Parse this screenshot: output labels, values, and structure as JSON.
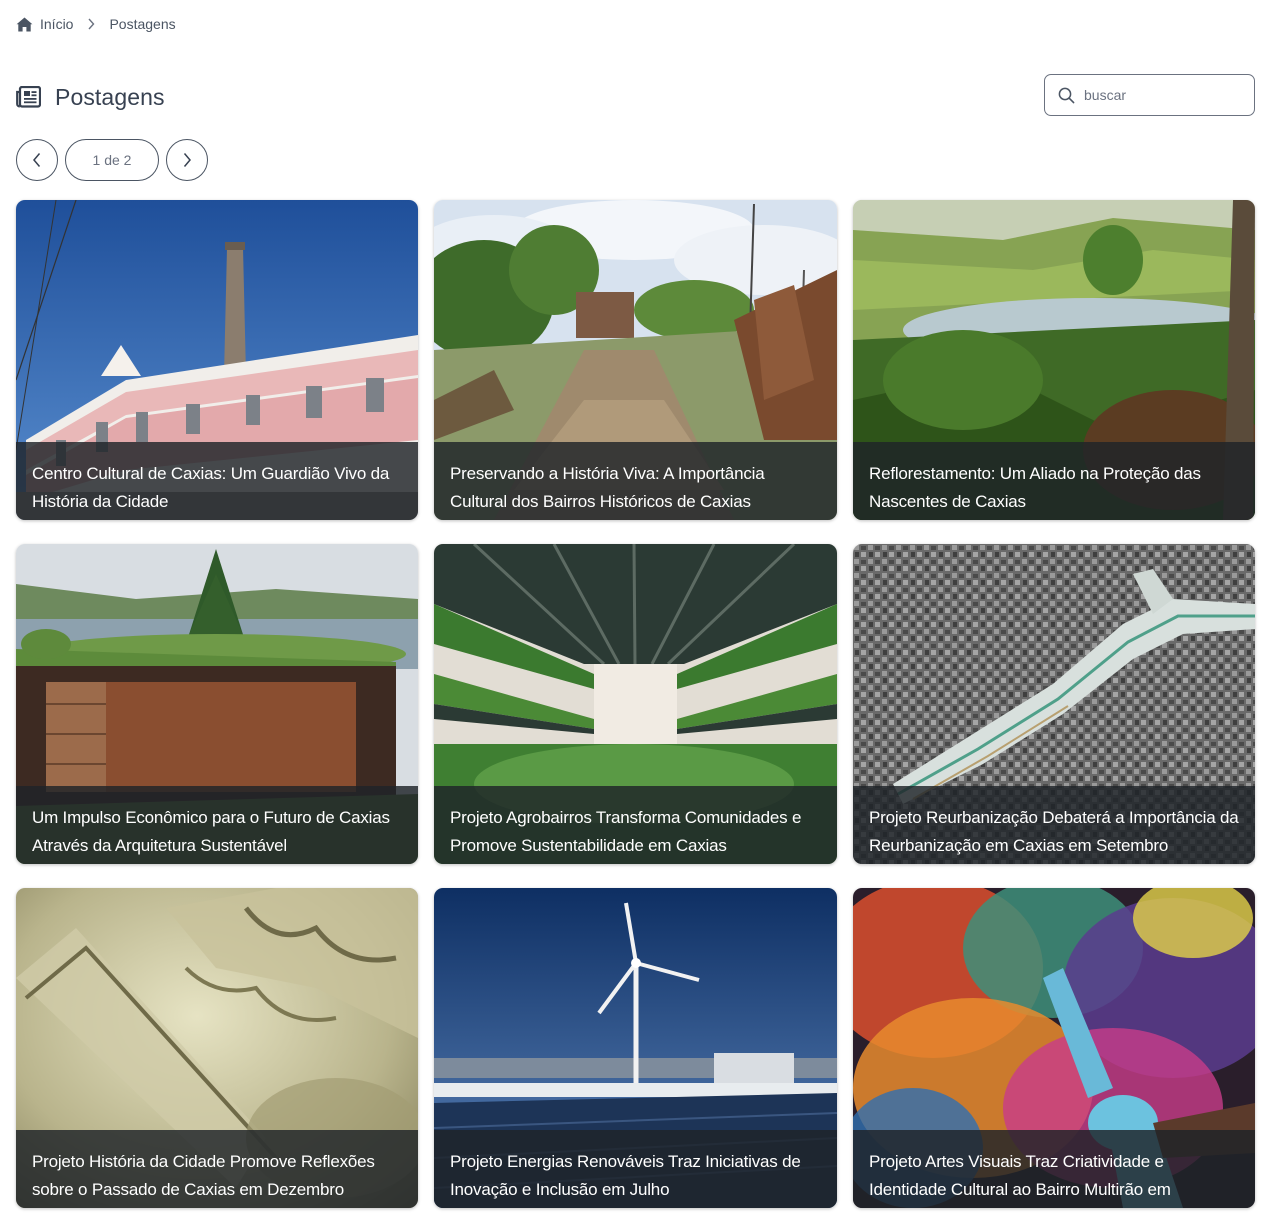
{
  "breadcrumb": {
    "home_label": "Início",
    "current_label": "Postagens"
  },
  "header": {
    "title": "Postagens"
  },
  "search": {
    "placeholder": "buscar"
  },
  "pager": {
    "label": "1 de 2"
  },
  "posts": [
    {
      "title": "Centro Cultural de Caxias: Um Guardião Vivo da História da Cidade"
    },
    {
      "title": "Preservando a História Viva: A Importância Cultural dos Bairros Históricos de Caxias"
    },
    {
      "title": "Reflorestamento: Um Aliado na Proteção das Nascentes de Caxias"
    },
    {
      "title": "Um Impulso Econômico para o Futuro de Caxias Através da Arquitetura Sustentável"
    },
    {
      "title": "Projeto Agrobairros Transforma Comunidades e Promove Sustentabilidade em Caxias"
    },
    {
      "title": "Projeto Reurbanização Debaterá a Importância da Reurbanização em Caxias em Setembro"
    },
    {
      "title": "Projeto História da Cidade Promove Reflexões sobre o Passado de Caxias em Dezembro"
    },
    {
      "title": "Projeto Energias Renováveis Traz Iniciativas de Inovação e Inclusão em Julho"
    },
    {
      "title": "Projeto Artes Visuais Traz Criatividade e Identidade Cultural ao Bairro Multirão em"
    }
  ]
}
